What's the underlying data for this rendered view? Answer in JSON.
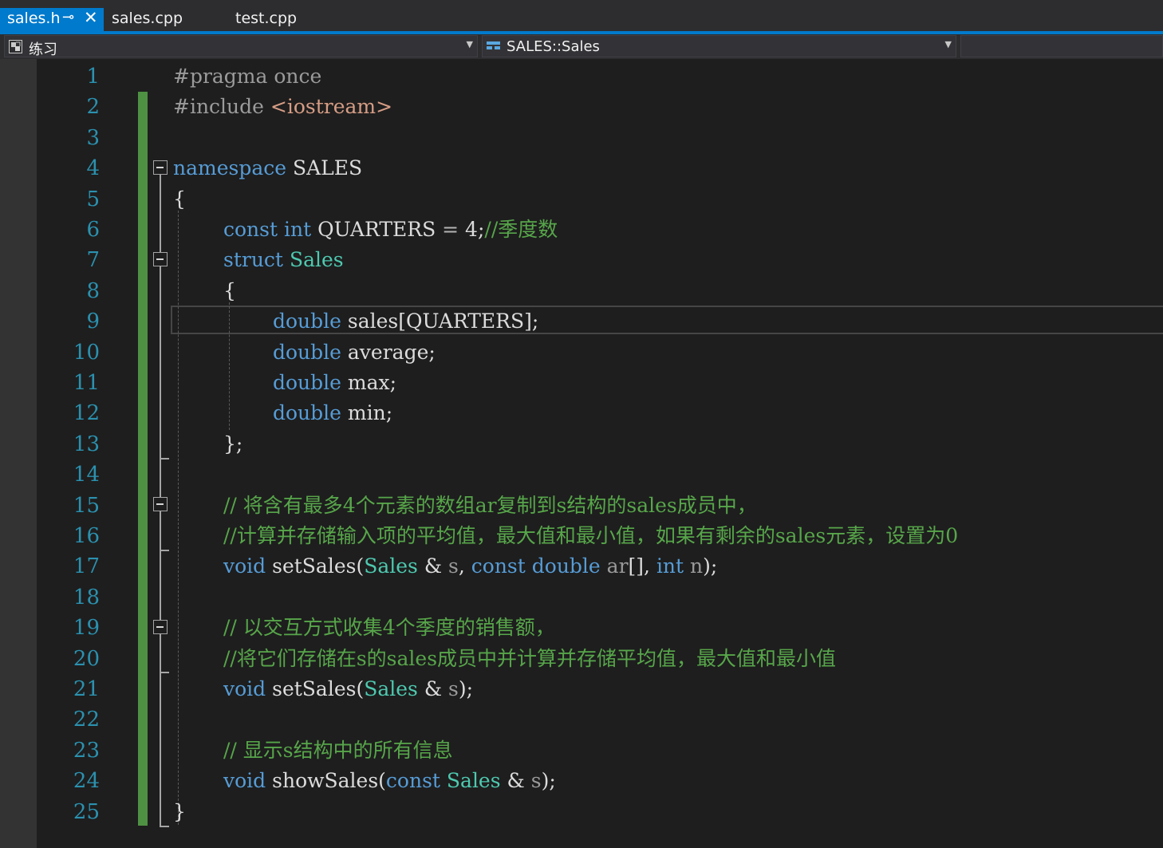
{
  "tabs": [
    {
      "label": "sales.h",
      "active": true,
      "pinned": true
    },
    {
      "label": "sales.cpp",
      "active": false
    },
    {
      "label": "test.cpp",
      "active": false
    }
  ],
  "nav": {
    "project": "练习",
    "scope": "SALES::Sales",
    "member": ""
  },
  "colors": {
    "accent": "#007acc",
    "keyword": "#569cd6",
    "type": "#4ec9b0",
    "comment": "#57a64a",
    "line_number": "#2b91af",
    "text": "#dcdcdc"
  },
  "editor": {
    "current_line": 9,
    "lines": [
      {
        "n": "1",
        "indent": 0,
        "tokens": [
          {
            "t": "#pragma once",
            "c": "pre"
          }
        ]
      },
      {
        "n": "2",
        "indent": 0,
        "tokens": [
          {
            "t": "#include ",
            "c": "pre"
          },
          {
            "t": "<iostream>",
            "c": "str"
          }
        ]
      },
      {
        "n": "3",
        "indent": 0,
        "tokens": []
      },
      {
        "n": "4",
        "indent": 0,
        "tokens": [
          {
            "t": "namespace",
            "c": "kw"
          },
          {
            "t": " SALES",
            "c": "txt"
          }
        ]
      },
      {
        "n": "5",
        "indent": 0,
        "tokens": [
          {
            "t": "{",
            "c": "txt"
          }
        ]
      },
      {
        "n": "6",
        "indent": 1,
        "tokens": [
          {
            "t": "const",
            "c": "kw"
          },
          {
            "t": " ",
            "c": "txt"
          },
          {
            "t": "int",
            "c": "kw"
          },
          {
            "t": " QUARTERS ",
            "c": "txt"
          },
          {
            "t": "=",
            "c": "op"
          },
          {
            "t": " 4;",
            "c": "txt"
          },
          {
            "t": "//季度数",
            "c": "cmt"
          }
        ]
      },
      {
        "n": "7",
        "indent": 1,
        "tokens": [
          {
            "t": "struct",
            "c": "kw"
          },
          {
            "t": " ",
            "c": "txt"
          },
          {
            "t": "Sales",
            "c": "type"
          }
        ]
      },
      {
        "n": "8",
        "indent": 1,
        "tokens": [
          {
            "t": "{",
            "c": "txt"
          }
        ]
      },
      {
        "n": "9",
        "indent": 2,
        "tokens": [
          {
            "t": "double",
            "c": "kw"
          },
          {
            "t": " sales[QUARTERS];",
            "c": "txt"
          }
        ]
      },
      {
        "n": "10",
        "indent": 2,
        "tokens": [
          {
            "t": "double",
            "c": "kw"
          },
          {
            "t": " average;",
            "c": "txt"
          }
        ]
      },
      {
        "n": "11",
        "indent": 2,
        "tokens": [
          {
            "t": "double",
            "c": "kw"
          },
          {
            "t": " max;",
            "c": "txt"
          }
        ]
      },
      {
        "n": "12",
        "indent": 2,
        "tokens": [
          {
            "t": "double",
            "c": "kw"
          },
          {
            "t": " min;",
            "c": "txt"
          }
        ]
      },
      {
        "n": "13",
        "indent": 1,
        "tokens": [
          {
            "t": "};",
            "c": "txt"
          }
        ]
      },
      {
        "n": "14",
        "indent": 0,
        "tokens": []
      },
      {
        "n": "15",
        "indent": 1,
        "tokens": [
          {
            "t": "// 将含有最多4个元素的数组ar复制到s结构的sales成员中，",
            "c": "cmt"
          }
        ]
      },
      {
        "n": "16",
        "indent": 1,
        "tokens": [
          {
            "t": "//计算并存储输入项的平均值，最大值和最小值，如果有剩余的sales元素，设置为0",
            "c": "cmt"
          }
        ]
      },
      {
        "n": "17",
        "indent": 1,
        "tokens": [
          {
            "t": "void",
            "c": "kw"
          },
          {
            "t": " setSales(",
            "c": "txt"
          },
          {
            "t": "Sales",
            "c": "type"
          },
          {
            "t": " & ",
            "c": "txt"
          },
          {
            "t": "s",
            "c": "param"
          },
          {
            "t": ", ",
            "c": "txt"
          },
          {
            "t": "const",
            "c": "kw"
          },
          {
            "t": " ",
            "c": "txt"
          },
          {
            "t": "double",
            "c": "kw"
          },
          {
            "t": " ",
            "c": "txt"
          },
          {
            "t": "ar",
            "c": "param"
          },
          {
            "t": "[], ",
            "c": "txt"
          },
          {
            "t": "int",
            "c": "kw"
          },
          {
            "t": " ",
            "c": "txt"
          },
          {
            "t": "n",
            "c": "param"
          },
          {
            "t": ");",
            "c": "txt"
          }
        ]
      },
      {
        "n": "18",
        "indent": 0,
        "tokens": []
      },
      {
        "n": "19",
        "indent": 1,
        "tokens": [
          {
            "t": "// 以交互方式收集4个季度的销售额，",
            "c": "cmt"
          }
        ]
      },
      {
        "n": "20",
        "indent": 1,
        "tokens": [
          {
            "t": "//将它们存储在s的sales成员中并计算并存储平均值，最大值和最小值",
            "c": "cmt"
          }
        ]
      },
      {
        "n": "21",
        "indent": 1,
        "tokens": [
          {
            "t": "void",
            "c": "kw"
          },
          {
            "t": " setSales(",
            "c": "txt"
          },
          {
            "t": "Sales",
            "c": "type"
          },
          {
            "t": " & ",
            "c": "txt"
          },
          {
            "t": "s",
            "c": "param"
          },
          {
            "t": ");",
            "c": "txt"
          }
        ]
      },
      {
        "n": "22",
        "indent": 0,
        "tokens": []
      },
      {
        "n": "23",
        "indent": 1,
        "tokens": [
          {
            "t": "// 显示s结构中的所有信息",
            "c": "cmt"
          }
        ]
      },
      {
        "n": "24",
        "indent": 1,
        "tokens": [
          {
            "t": "void",
            "c": "kw"
          },
          {
            "t": " showSales(",
            "c": "txt"
          },
          {
            "t": "const",
            "c": "kw"
          },
          {
            "t": " ",
            "c": "txt"
          },
          {
            "t": "Sales",
            "c": "type"
          },
          {
            "t": " & ",
            "c": "txt"
          },
          {
            "t": "s",
            "c": "param"
          },
          {
            "t": ");",
            "c": "txt"
          }
        ]
      },
      {
        "n": "25",
        "indent": 0,
        "tokens": [
          {
            "t": "}",
            "c": "txt"
          }
        ]
      }
    ]
  }
}
